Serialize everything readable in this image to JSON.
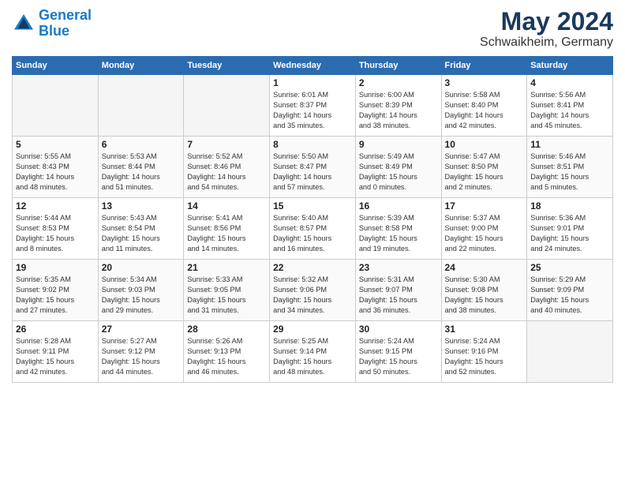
{
  "header": {
    "logo_line1": "General",
    "logo_line2": "Blue",
    "title": "May 2024",
    "subtitle": "Schwaikheim, Germany"
  },
  "weekdays": [
    "Sunday",
    "Monday",
    "Tuesday",
    "Wednesday",
    "Thursday",
    "Friday",
    "Saturday"
  ],
  "weeks": [
    [
      {
        "day": "",
        "info": ""
      },
      {
        "day": "",
        "info": ""
      },
      {
        "day": "",
        "info": ""
      },
      {
        "day": "1",
        "info": "Sunrise: 6:01 AM\nSunset: 8:37 PM\nDaylight: 14 hours\nand 35 minutes."
      },
      {
        "day": "2",
        "info": "Sunrise: 6:00 AM\nSunset: 8:39 PM\nDaylight: 14 hours\nand 38 minutes."
      },
      {
        "day": "3",
        "info": "Sunrise: 5:58 AM\nSunset: 8:40 PM\nDaylight: 14 hours\nand 42 minutes."
      },
      {
        "day": "4",
        "info": "Sunrise: 5:56 AM\nSunset: 8:41 PM\nDaylight: 14 hours\nand 45 minutes."
      }
    ],
    [
      {
        "day": "5",
        "info": "Sunrise: 5:55 AM\nSunset: 8:43 PM\nDaylight: 14 hours\nand 48 minutes."
      },
      {
        "day": "6",
        "info": "Sunrise: 5:53 AM\nSunset: 8:44 PM\nDaylight: 14 hours\nand 51 minutes."
      },
      {
        "day": "7",
        "info": "Sunrise: 5:52 AM\nSunset: 8:46 PM\nDaylight: 14 hours\nand 54 minutes."
      },
      {
        "day": "8",
        "info": "Sunrise: 5:50 AM\nSunset: 8:47 PM\nDaylight: 14 hours\nand 57 minutes."
      },
      {
        "day": "9",
        "info": "Sunrise: 5:49 AM\nSunset: 8:49 PM\nDaylight: 15 hours\nand 0 minutes."
      },
      {
        "day": "10",
        "info": "Sunrise: 5:47 AM\nSunset: 8:50 PM\nDaylight: 15 hours\nand 2 minutes."
      },
      {
        "day": "11",
        "info": "Sunrise: 5:46 AM\nSunset: 8:51 PM\nDaylight: 15 hours\nand 5 minutes."
      }
    ],
    [
      {
        "day": "12",
        "info": "Sunrise: 5:44 AM\nSunset: 8:53 PM\nDaylight: 15 hours\nand 8 minutes."
      },
      {
        "day": "13",
        "info": "Sunrise: 5:43 AM\nSunset: 8:54 PM\nDaylight: 15 hours\nand 11 minutes."
      },
      {
        "day": "14",
        "info": "Sunrise: 5:41 AM\nSunset: 8:56 PM\nDaylight: 15 hours\nand 14 minutes."
      },
      {
        "day": "15",
        "info": "Sunrise: 5:40 AM\nSunset: 8:57 PM\nDaylight: 15 hours\nand 16 minutes."
      },
      {
        "day": "16",
        "info": "Sunrise: 5:39 AM\nSunset: 8:58 PM\nDaylight: 15 hours\nand 19 minutes."
      },
      {
        "day": "17",
        "info": "Sunrise: 5:37 AM\nSunset: 9:00 PM\nDaylight: 15 hours\nand 22 minutes."
      },
      {
        "day": "18",
        "info": "Sunrise: 5:36 AM\nSunset: 9:01 PM\nDaylight: 15 hours\nand 24 minutes."
      }
    ],
    [
      {
        "day": "19",
        "info": "Sunrise: 5:35 AM\nSunset: 9:02 PM\nDaylight: 15 hours\nand 27 minutes."
      },
      {
        "day": "20",
        "info": "Sunrise: 5:34 AM\nSunset: 9:03 PM\nDaylight: 15 hours\nand 29 minutes."
      },
      {
        "day": "21",
        "info": "Sunrise: 5:33 AM\nSunset: 9:05 PM\nDaylight: 15 hours\nand 31 minutes."
      },
      {
        "day": "22",
        "info": "Sunrise: 5:32 AM\nSunset: 9:06 PM\nDaylight: 15 hours\nand 34 minutes."
      },
      {
        "day": "23",
        "info": "Sunrise: 5:31 AM\nSunset: 9:07 PM\nDaylight: 15 hours\nand 36 minutes."
      },
      {
        "day": "24",
        "info": "Sunrise: 5:30 AM\nSunset: 9:08 PM\nDaylight: 15 hours\nand 38 minutes."
      },
      {
        "day": "25",
        "info": "Sunrise: 5:29 AM\nSunset: 9:09 PM\nDaylight: 15 hours\nand 40 minutes."
      }
    ],
    [
      {
        "day": "26",
        "info": "Sunrise: 5:28 AM\nSunset: 9:11 PM\nDaylight: 15 hours\nand 42 minutes."
      },
      {
        "day": "27",
        "info": "Sunrise: 5:27 AM\nSunset: 9:12 PM\nDaylight: 15 hours\nand 44 minutes."
      },
      {
        "day": "28",
        "info": "Sunrise: 5:26 AM\nSunset: 9:13 PM\nDaylight: 15 hours\nand 46 minutes."
      },
      {
        "day": "29",
        "info": "Sunrise: 5:25 AM\nSunset: 9:14 PM\nDaylight: 15 hours\nand 48 minutes."
      },
      {
        "day": "30",
        "info": "Sunrise: 5:24 AM\nSunset: 9:15 PM\nDaylight: 15 hours\nand 50 minutes."
      },
      {
        "day": "31",
        "info": "Sunrise: 5:24 AM\nSunset: 9:16 PM\nDaylight: 15 hours\nand 52 minutes."
      },
      {
        "day": "",
        "info": ""
      }
    ]
  ]
}
